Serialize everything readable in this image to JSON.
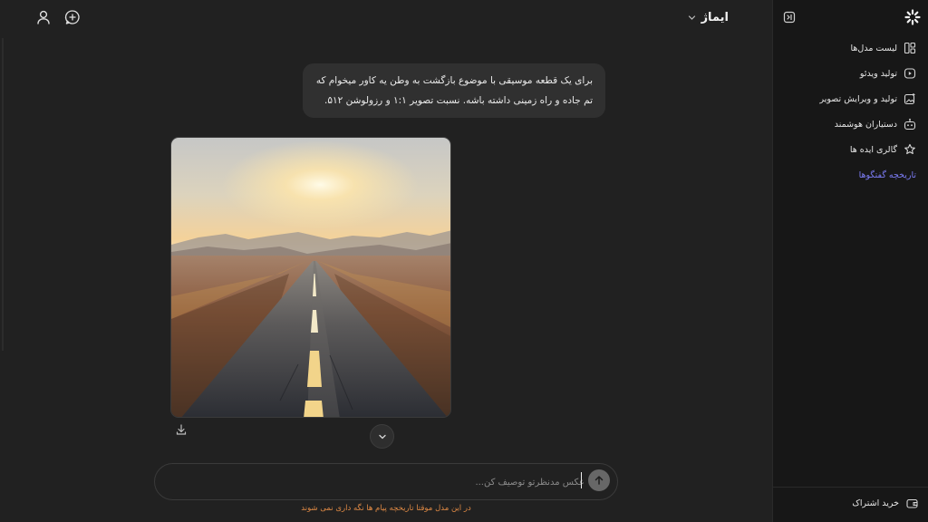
{
  "header": {
    "model_name": "ایماژ",
    "icons": [
      "user-icon",
      "new-chat-icon",
      "chevron-down-icon"
    ]
  },
  "conversation": {
    "user_message_line1": "برای یک قطعه موسیقی با موضوع بازگشت به وطن یه کاور میخوام که",
    "user_message_line2": "تم جاده و راه زمینی داشته باشه. نسبت تصویر ۱:۱ و رزولوشن ۵۱۲."
  },
  "composer": {
    "placeholder": "عکس مدنظرتو توصیف کن...",
    "value": "",
    "notice": "در این مدل موقتا تاریخچه پیام ها نگه داری نمی شوند",
    "accent_color": "#e08a45"
  },
  "sidebar": {
    "items": [
      {
        "label": "لیست مدل‌ها",
        "icon": "grid-icon"
      },
      {
        "label": "تولید ویدئو",
        "icon": "video-icon"
      },
      {
        "label": "تولید و ویرایش تصویر",
        "icon": "image-edit-icon"
      },
      {
        "label": "دستیاران هوشمند",
        "icon": "robot-icon"
      },
      {
        "label": "گالری ایده ها",
        "icon": "gallery-icon"
      }
    ],
    "history_label": "تاریخچه گفتگوها",
    "history_color": "#7c7cf5",
    "subscription_label": "خرید اشتراک"
  }
}
